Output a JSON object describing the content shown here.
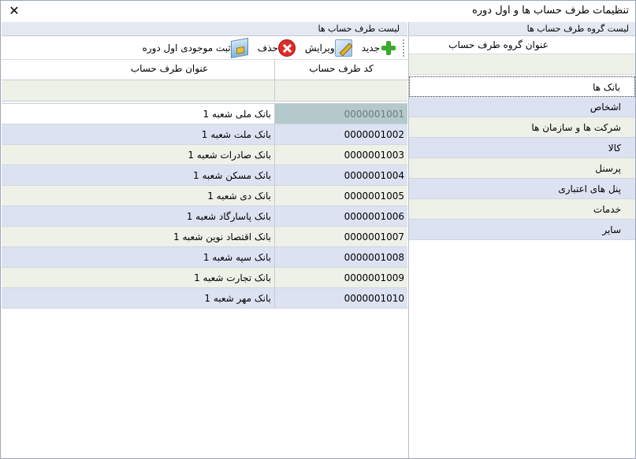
{
  "window": {
    "title": "تنظیمات طرف حساب ها و اول دوره",
    "close_glyph": "✕"
  },
  "groups_panel": {
    "header": "لیست گروه طرف حساب ها",
    "column_header": "عنوان گروه طرف حساب",
    "items": [
      {
        "label": "بانک ها"
      },
      {
        "label": "اشخاص"
      },
      {
        "label": "شرکت ها و سازمان ها"
      },
      {
        "label": "کالا"
      },
      {
        "label": "پرسنل"
      },
      {
        "label": "پنل های اعتباری"
      },
      {
        "label": "خدمات"
      },
      {
        "label": "سایر"
      }
    ],
    "selected_index": 0
  },
  "accounts_panel": {
    "header": "لیست طرف حساب ها",
    "toolbar": {
      "new_label": "جدید",
      "new_icon": "plus-icon",
      "edit_label": "ویرایش",
      "edit_icon": "edit-icon",
      "delete_label": "حذف",
      "delete_icon": "delete-icon",
      "stock_label": "ثبت موجودی اول دوره",
      "stock_icon": "stock-icon"
    },
    "columns": {
      "code": "کد طرف حساب",
      "title": "عنوان طرف حساب"
    },
    "rows": [
      {
        "code": "0000001001",
        "title": "بانک ملی شعبه 1"
      },
      {
        "code": "0000001002",
        "title": "بانک ملت شعبه 1"
      },
      {
        "code": "0000001003",
        "title": "بانک صادرات شعبه 1"
      },
      {
        "code": "0000001004",
        "title": "بانک مسکن شعبه 1"
      },
      {
        "code": "0000001005",
        "title": "بانک دی شعبه 1"
      },
      {
        "code": "0000001006",
        "title": "بانک پاسارگاد شعبه 1"
      },
      {
        "code": "0000001007",
        "title": "بانک اقتصاد نوین شعبه 1"
      },
      {
        "code": "0000001008",
        "title": "بانک سپه شعبه 1"
      },
      {
        "code": "0000001009",
        "title": "بانک تجارت شعبه 1"
      },
      {
        "code": "0000001010",
        "title": "بانک مهر شعبه 1"
      }
    ]
  },
  "colors": {
    "row_even": "#dde2f3",
    "row_odd": "#eef1e7",
    "selected_code_cell": "#b4c9cb",
    "header_bg": "#e4e8f0",
    "add_green": "#3aa82a",
    "delete_red": "#e02a2a"
  }
}
